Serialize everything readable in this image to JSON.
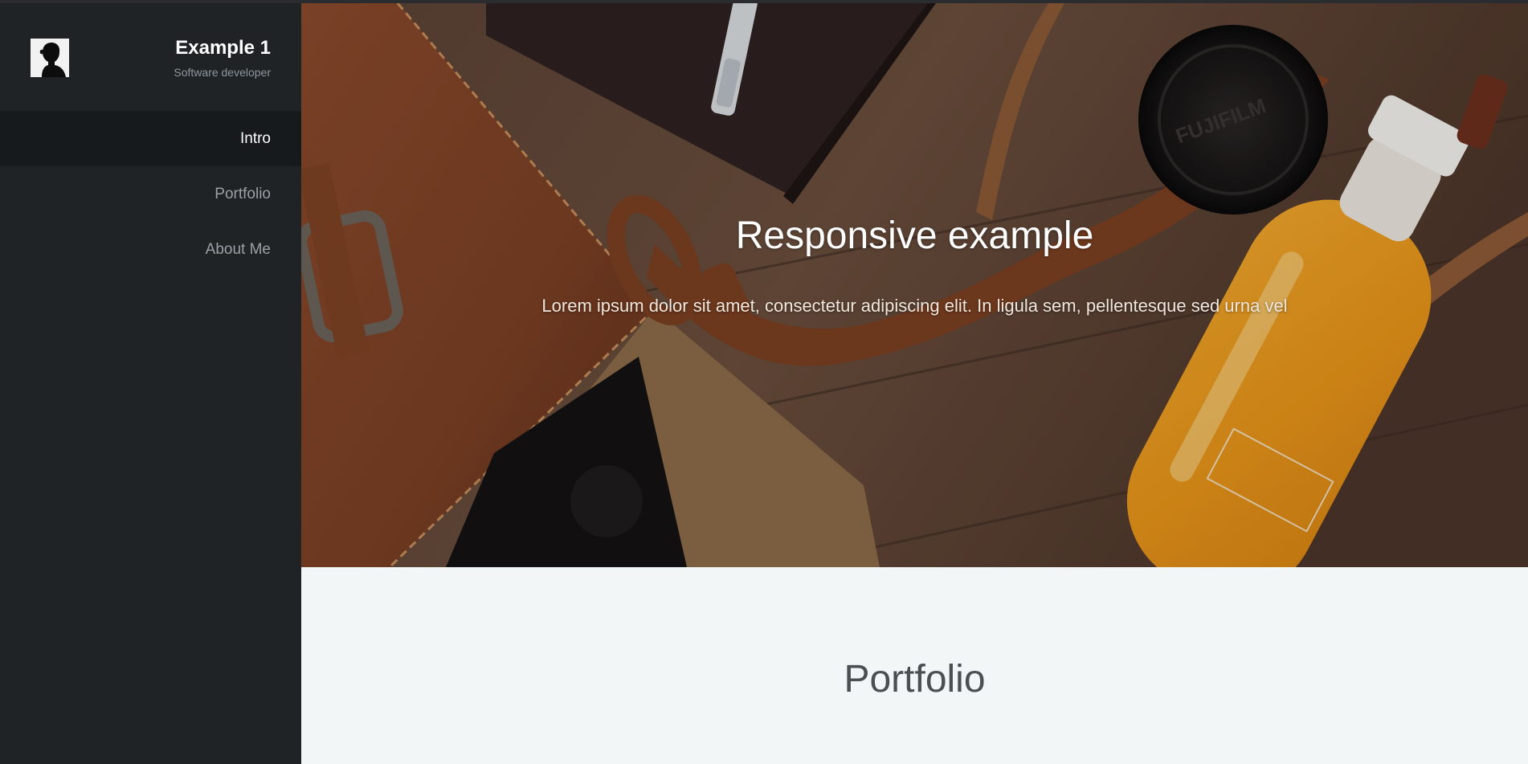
{
  "profile": {
    "name": "Example 1",
    "role": "Software developer",
    "avatar_icon": "silhouette-avatar-icon"
  },
  "nav": {
    "items": [
      {
        "label": "Intro",
        "active": true
      },
      {
        "label": "Portfolio",
        "active": false
      },
      {
        "label": "About Me",
        "active": false
      }
    ]
  },
  "hero": {
    "title": "Responsive example",
    "text": "Lorem ipsum dolor sit amet, consectetur adipiscing elit. In ligula sem, pellentesque sed urna vel"
  },
  "portfolio": {
    "title": "Portfolio"
  },
  "colors": {
    "sidebar": "#1f2326",
    "sidebar_active": "#171a1c",
    "section_bg": "#f3f6f6"
  }
}
